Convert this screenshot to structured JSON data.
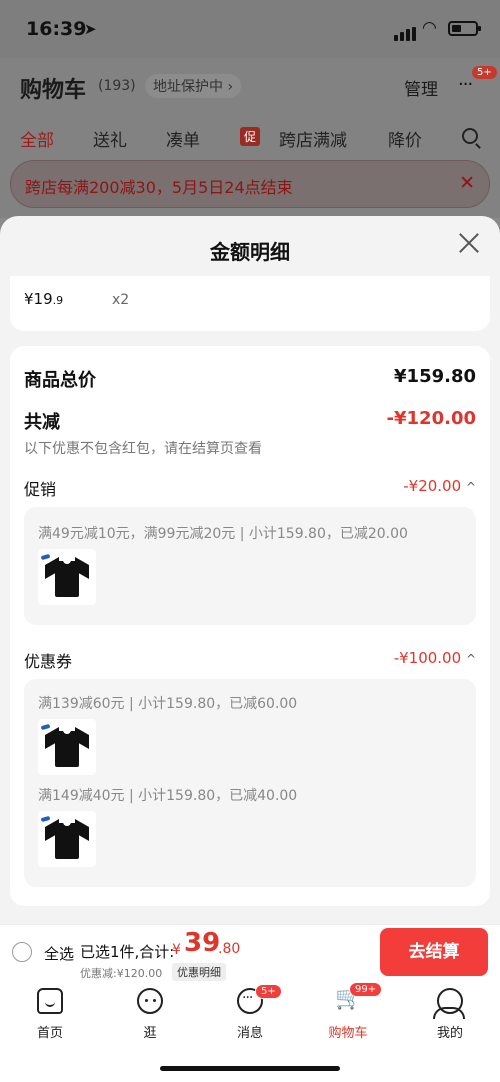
{
  "status": {
    "time": "16:39",
    "location_arrow": "➤"
  },
  "cart_header": {
    "title": "购物车",
    "count": "(193)",
    "address_protect": "地址保护中 ›",
    "manage": "管理",
    "more_badge": "5+",
    "tabs": [
      "全部",
      "送礼",
      "凑单",
      "跨店满减",
      "降价"
    ],
    "promo_tag": "促",
    "promo_banner": "跨店每满200减30，5月5日24点结束"
  },
  "sheet": {
    "title": "金额明细",
    "item": {
      "price_int": "¥19",
      "price_dec": ".9",
      "qty": "x2"
    },
    "goods_total_label": "商品总价",
    "goods_total_value": "¥159.80",
    "total_reduce_label": "共减",
    "total_reduce_value": "-¥120.00",
    "note": "以下优惠不包含红包，请在结算页查看",
    "promotion": {
      "label": "促销",
      "value": "-¥20.00",
      "line": "满49元减10元，满99元减20元 | 小计159.80，已减20.00"
    },
    "coupon": {
      "label": "优惠券",
      "value": "-¥100.00",
      "line1": "满139减60元 | 小计159.80，已减60.00",
      "line2": "满149减40元 | 小计159.80，已减40.00"
    }
  },
  "checkout": {
    "select_all": "全选",
    "selected_info": "已选1件,合计:",
    "total_symbol": "¥",
    "total_int": "39",
    "total_dec": ".80",
    "discount": "优惠减:¥120.00",
    "detail_chip": "优惠明细",
    "button": "去结算"
  },
  "tabbar": {
    "items": [
      "首页",
      "逛",
      "消息",
      "购物车",
      "我的"
    ],
    "msg_badge": "5+",
    "cart_badge": "99+"
  },
  "colors": {
    "accent": "#e0352b",
    "button": "#f23d3a"
  }
}
